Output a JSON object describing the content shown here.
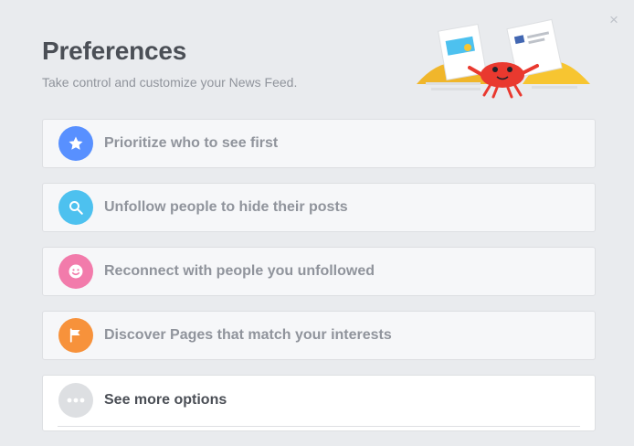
{
  "dialog": {
    "title": "Preferences",
    "subtitle": "Take control and customize your News Feed.",
    "close_glyph": "×"
  },
  "options": [
    {
      "label": "Prioritize who to see first",
      "icon": "star-icon",
      "color": "#5890ff"
    },
    {
      "label": "Unfollow people to hide their posts",
      "icon": "search-icon",
      "color": "#4dc1ef"
    },
    {
      "label": "Reconnect with people you unfollowed",
      "icon": "smiley-icon",
      "color": "#f27bab"
    },
    {
      "label": "Discover Pages that match your interests",
      "icon": "flag-icon",
      "color": "#f7923b"
    },
    {
      "label": "See more options",
      "icon": "more-icon",
      "color": "#dddfe2"
    }
  ],
  "colors": {
    "background": "#e9ebee",
    "title": "#4b4f56",
    "muted_text": "#90949c",
    "card": "#f6f7f9",
    "border": "#dddfe2"
  }
}
